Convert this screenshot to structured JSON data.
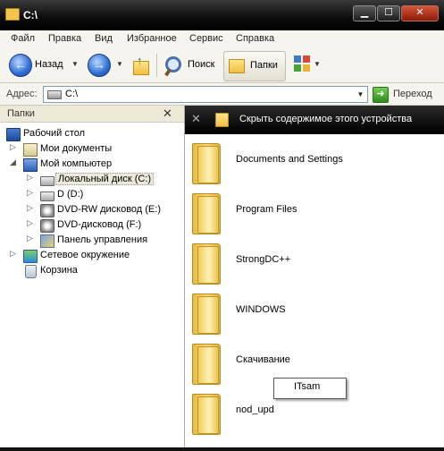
{
  "window": {
    "title": "C:\\",
    "minimize": "▁",
    "maximize": "☐",
    "close": "✕"
  },
  "menu": [
    "Файл",
    "Правка",
    "Вид",
    "Избранное",
    "Сервис",
    "Справка"
  ],
  "toolbar": {
    "back_label": "Назад",
    "search_label": "Поиск",
    "folders_label": "Папки"
  },
  "address": {
    "label": "Адрес:",
    "value": "C:\\",
    "go_label": "Переход"
  },
  "left_panel": {
    "title": "Папки",
    "close": "✕",
    "tree": [
      {
        "label": "Рабочий стол",
        "icon": "desktop-icon"
      },
      {
        "label": "Мои документы",
        "icon": "my-documents-icon"
      },
      {
        "label": "Мой компьютер",
        "icon": "my-computer-icon"
      },
      {
        "label": "Локальный диск (C:)",
        "icon": "local-disk-icon",
        "selected": true
      },
      {
        "label": "D (D:)",
        "icon": "disk-icon"
      },
      {
        "label": "DVD-RW дисковод (E:)",
        "icon": "dvd-rw-icon"
      },
      {
        "label": "DVD-дисковод (F:)",
        "icon": "dvd-icon"
      },
      {
        "label": "Панель управления",
        "icon": "control-panel-icon"
      },
      {
        "label": "Сетевое окружение",
        "icon": "network-icon"
      },
      {
        "label": "Корзина",
        "icon": "recycle-bin-icon"
      }
    ]
  },
  "right_panel": {
    "tasks_close": "✕",
    "tasks_text": "Скрыть содержимое этого устройства",
    "folders": [
      "Documents and Settings",
      "Program Files",
      "StrongDC++",
      "WINDOWS",
      "Скачивание",
      "nod_upd"
    ],
    "tooltip": "ITsam"
  }
}
